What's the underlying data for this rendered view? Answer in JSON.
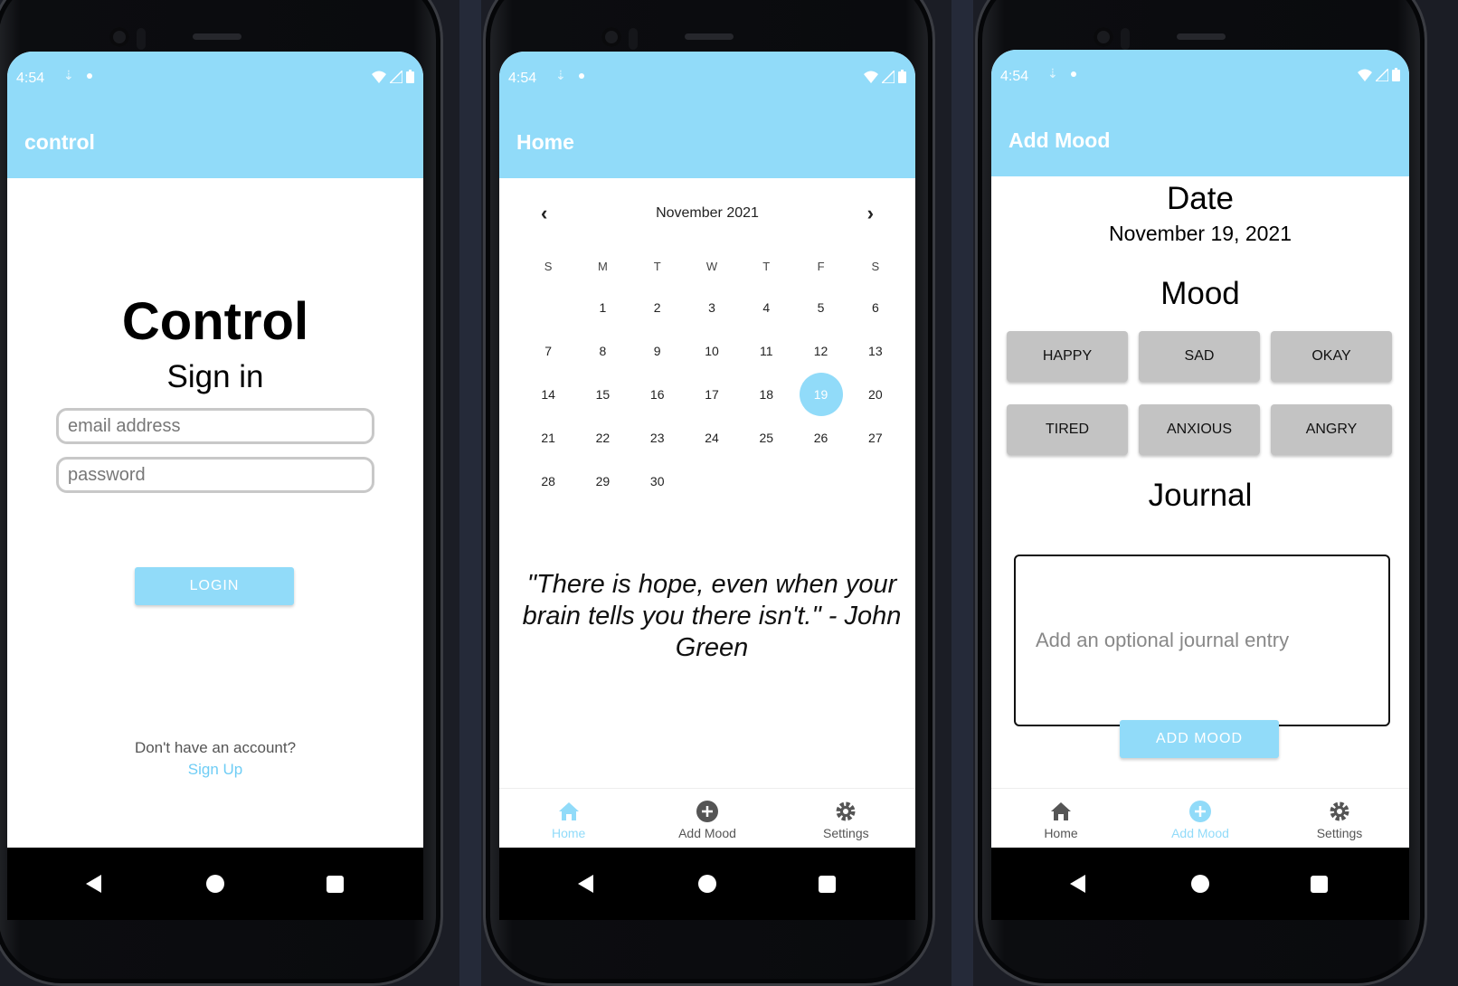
{
  "status": {
    "time": "4:54"
  },
  "login": {
    "app_title": "control",
    "brand": "Control",
    "subtitle": "Sign in",
    "email_placeholder": "email address",
    "password_placeholder": "password",
    "login_label": "LOGIN",
    "no_account": "Don't have an account?",
    "signup_link": "Sign Up"
  },
  "home": {
    "app_title": "Home",
    "month_label": "November 2021",
    "weekdays": [
      "S",
      "M",
      "T",
      "W",
      "T",
      "F",
      "S"
    ],
    "first_weekday_offset": 1,
    "days_in_month": 30,
    "selected_day": 19,
    "quote": "\"There is hope, even when your brain tells you there isn't.\" - John Green"
  },
  "add_mood": {
    "app_title": "Add Mood",
    "date_label": "Date",
    "date_value": "November 19, 2021",
    "mood_label": "Mood",
    "moods": [
      "HAPPY",
      "SAD",
      "OKAY",
      "TIRED",
      "ANXIOUS",
      "ANGRY"
    ],
    "journal_label": "Journal",
    "journal_placeholder": "Add an optional journal entry",
    "submit_label": "ADD MOOD"
  },
  "tabs": [
    {
      "label": "Home",
      "icon": "home-icon"
    },
    {
      "label": "Add Mood",
      "icon": "add-circle-icon"
    },
    {
      "label": "Settings",
      "icon": "gear-icon"
    }
  ],
  "colors": {
    "accent": "#91dbf9",
    "mood_button": "#c3c3c3",
    "link": "#6fcdf5"
  }
}
